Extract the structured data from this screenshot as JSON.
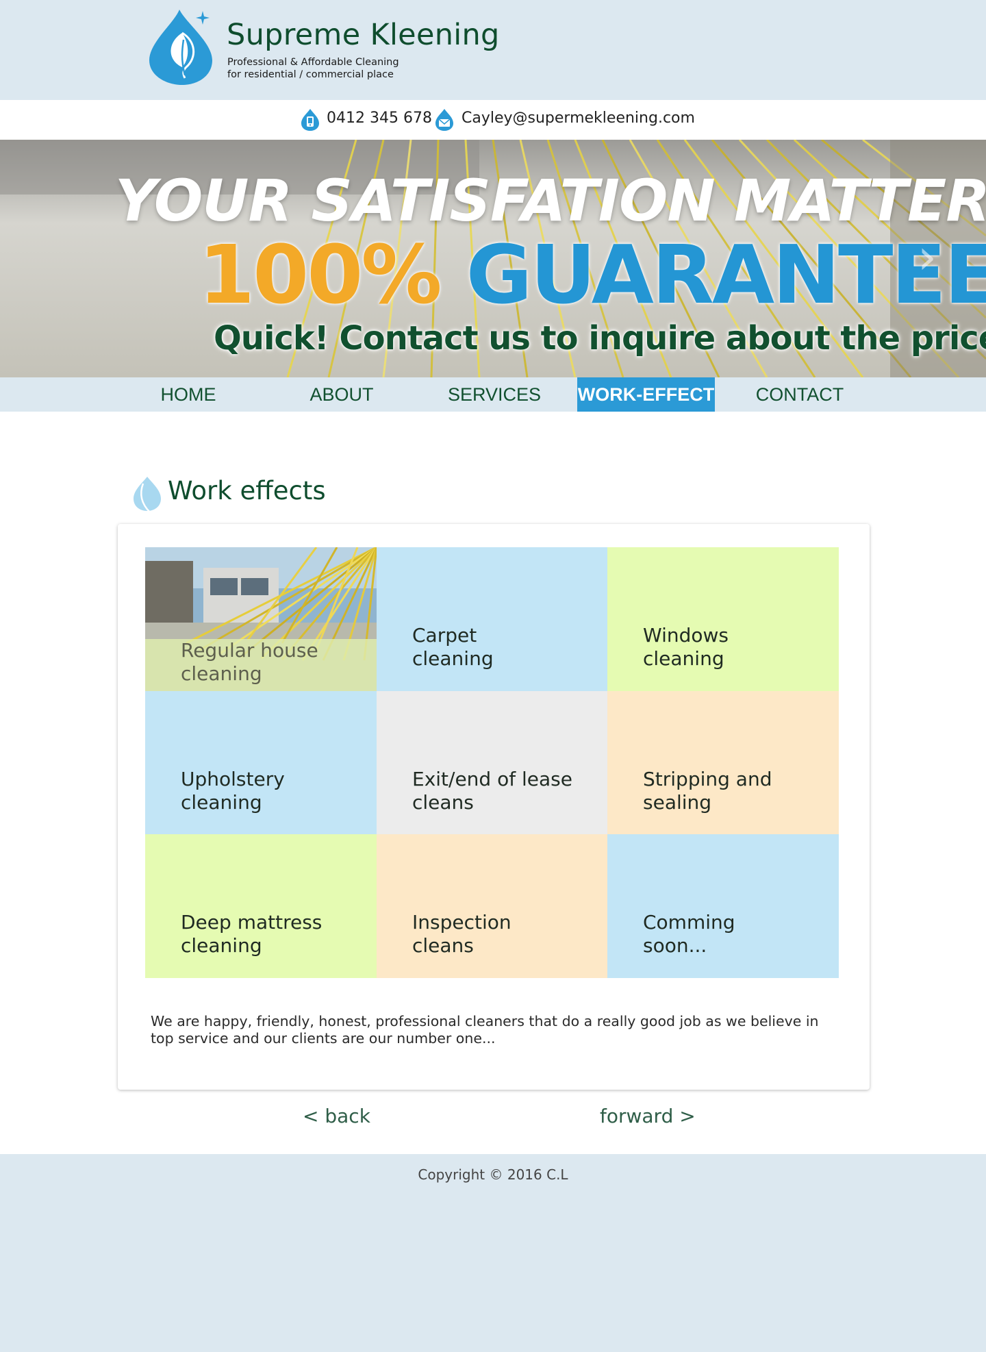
{
  "header": {
    "brand_name": "Supreme Kleening",
    "tagline_1": "Professional & Affordable Cleaning",
    "tagline_2": "for residential / commercial place",
    "logo_icon": "water-drop-leaf-logo"
  },
  "contact": {
    "phone": "0412 345 678",
    "email": "Cayley@supermekleening.com",
    "phone_icon": "phone-drop-icon",
    "email_icon": "mail-drop-icon"
  },
  "hero": {
    "line1": "YOUR SATISFATION MATTERS",
    "line2_pct": "100%",
    "line2_word": "GUARANTEED",
    "line3": "Quick! Contact us to inquire about the price!",
    "next_arrow": "›"
  },
  "nav": {
    "items": [
      {
        "label": "HOME",
        "active": false
      },
      {
        "label": "ABOUT",
        "active": false
      },
      {
        "label": "SERVICES",
        "active": false
      },
      {
        "label": "WORK-EFFECT",
        "active": true
      },
      {
        "label": "CONTACT",
        "active": false
      }
    ]
  },
  "main": {
    "title": "Work effects",
    "tiles": [
      {
        "label_1": "Regular house",
        "label_2": "cleaning",
        "color": "photo"
      },
      {
        "label_1": "Carpet",
        "label_2": "cleaning",
        "color": "#c2e5f6"
      },
      {
        "label_1": "Windows",
        "label_2": "cleaning",
        "color": "#e5fbb2"
      },
      {
        "label_1": "Upholstery",
        "label_2": "cleaning",
        "color": "#c2e5f6"
      },
      {
        "label_1": "Exit/end of lease",
        "label_2": "cleans",
        "color": "#ececec"
      },
      {
        "label_1": "Stripping and",
        "label_2": "sealing",
        "color": "#fde8c7"
      },
      {
        "label_1": "Deep mattress",
        "label_2": "cleaning",
        "color": "#e5fbb2"
      },
      {
        "label_1": "Inspection",
        "label_2": "cleans",
        "color": "#fde8c7"
      },
      {
        "label_1": "Comming",
        "label_2": "soon...",
        "color": "#c2e5f6"
      }
    ],
    "description": "We are happy, friendly, honest, professional cleaners that do a really good job as we believe in top service and our clients are our number one...",
    "back_label": "< back",
    "forward_label": "forward >"
  },
  "footer": {
    "copyright": "Copyright © 2016 C.L"
  },
  "colors": {
    "brand_green": "#0f4d2e",
    "brand_blue": "#2b9ad6",
    "accent_orange": "#f3a928",
    "page_bg": "#dce8f0"
  }
}
